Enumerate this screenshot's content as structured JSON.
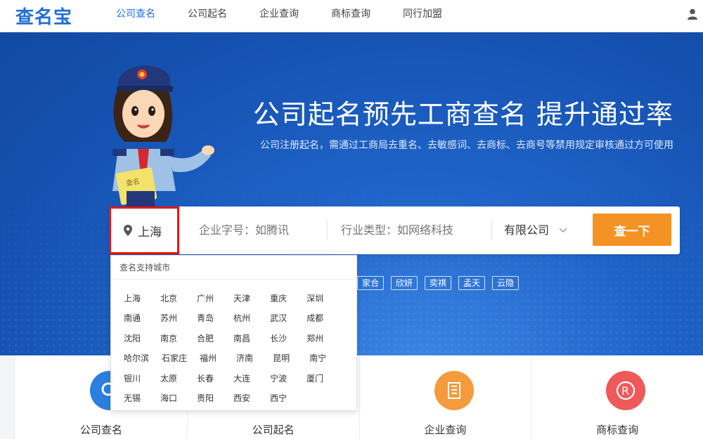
{
  "header": {
    "logo": "查名宝",
    "nav": [
      {
        "label": "公司查名",
        "active": true
      },
      {
        "label": "公司起名",
        "active": false
      },
      {
        "label": "企业查询",
        "active": false
      },
      {
        "label": "商标查询",
        "active": false
      },
      {
        "label": "同行加盟",
        "active": false
      }
    ],
    "user_icon": "user-icon"
  },
  "hero": {
    "title": "公司起名预先工商查名  提升通过率",
    "subtitle": "公司注册起名，需通过工商局去重名、去敏感词、去商标、去商号等禁用规定审核通过方可使用"
  },
  "search": {
    "city": "上海",
    "name_placeholder": "企业字号：如腾讯",
    "industry_placeholder": "行业类型：如网络科技",
    "company_type": "有限公司",
    "button": "查一下"
  },
  "tags": [
    "家合",
    "欣妍",
    "奕祺",
    "孟天",
    "云隐"
  ],
  "city_dropdown": {
    "header": "查名支持城市",
    "rows": [
      [
        "上海",
        "北京",
        "广州",
        "天津",
        "重庆",
        "深圳"
      ],
      [
        "南通",
        "苏州",
        "青岛",
        "杭州",
        "武汉",
        "成都"
      ],
      [
        "沈阳",
        "南京",
        "合肥",
        "南昌",
        "长沙",
        "郑州"
      ],
      [
        "哈尔滨",
        "石家庄",
        "福州",
        "济南",
        "昆明",
        "南宁"
      ],
      [
        "银川",
        "太原",
        "长春",
        "大连",
        "宁波",
        "厦门"
      ],
      [
        "无锡",
        "海口",
        "贵阳",
        "西安",
        "西宁"
      ]
    ]
  },
  "services": [
    {
      "label": "公司查名",
      "color": "#2a7fe0",
      "icon": "search-icon"
    },
    {
      "label": "公司起名",
      "color": "#3a8de6",
      "icon": "pen-icon"
    },
    {
      "label": "企业查询",
      "color": "#f49b3b",
      "icon": "building-icon"
    },
    {
      "label": "商标查询",
      "color": "#ee5a5a",
      "icon": "registered-icon"
    }
  ],
  "colors": {
    "brand": "#1f6fd4",
    "button": "#f49223",
    "highlight_border": "#e8150e"
  }
}
